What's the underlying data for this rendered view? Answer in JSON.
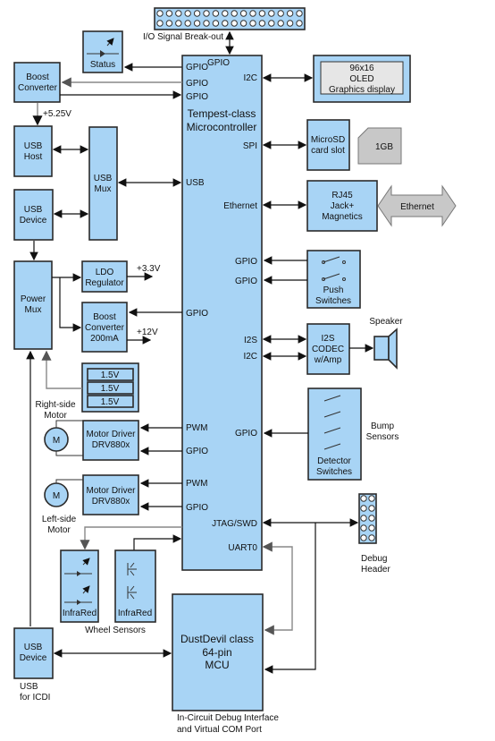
{
  "blocks": {
    "io_breakout": "I/O Signal Break-out",
    "status": "Status",
    "boost_top": [
      "Boost",
      "Converter"
    ],
    "usb_host": [
      "USB",
      "Host"
    ],
    "usb_mux": [
      "USB",
      "Mux"
    ],
    "usb_device": [
      "USB",
      "Device"
    ],
    "power_mux": [
      "Power",
      "Mux"
    ],
    "ldo": [
      "LDO",
      "Regulator"
    ],
    "boost_200": [
      "Boost",
      "Converter",
      "200mA"
    ],
    "batteries": [
      "1.5V",
      "1.5V",
      "1.5V"
    ],
    "right_motor": [
      "Right-side",
      "Motor"
    ],
    "left_motor": [
      "Left-side",
      "Motor"
    ],
    "motor_symbol": "M",
    "motor_driver": [
      "Motor Driver",
      "DRV880x"
    ],
    "infrared": "InfraRed",
    "wheel_sensors": "Wheel Sensors",
    "usb_icdi_device": [
      "USB",
      "Device"
    ],
    "usb_icdi_label": [
      "USB",
      "for ICDI"
    ],
    "mcu": [
      "Tempest-class",
      "Microcontroller"
    ],
    "dustdevil": [
      "DustDevil class",
      "64-pin",
      "MCU"
    ],
    "dustdevil_caption": [
      "In-Circuit Debug Interface",
      "and Virtual COM Port"
    ],
    "oled": [
      "96x16",
      "OLED",
      "Graphics display"
    ],
    "microsd": [
      "MicroSD",
      "card slot"
    ],
    "sd_card": "1GB",
    "rj45": [
      "RJ45",
      "Jack+",
      "Magnetics"
    ],
    "ethernet_bus": "Ethernet",
    "push_switches": [
      "Push",
      "Switches"
    ],
    "codec": [
      "I2S",
      "CODEC",
      "w/Amp"
    ],
    "speaker": "Speaker",
    "detector": [
      "Detector",
      "Switches"
    ],
    "bump": [
      "Bump",
      "Sensors"
    ],
    "debug_header": [
      "Debug",
      "Header"
    ]
  },
  "voltages": {
    "v525": "+5.25V",
    "v33": "+3.3V",
    "v12": "+12V"
  },
  "pins": {
    "gpio": "GPIO",
    "i2c": "I2C",
    "spi": "SPI",
    "usb": "USB",
    "ethernet": "Ethernet",
    "i2s": "I2S",
    "pwm": "PWM",
    "jtag": "JTAG/SWD",
    "uart": "UART0"
  },
  "colors": {
    "block": "#a8d4f5",
    "grey": "#c8c8c8"
  }
}
